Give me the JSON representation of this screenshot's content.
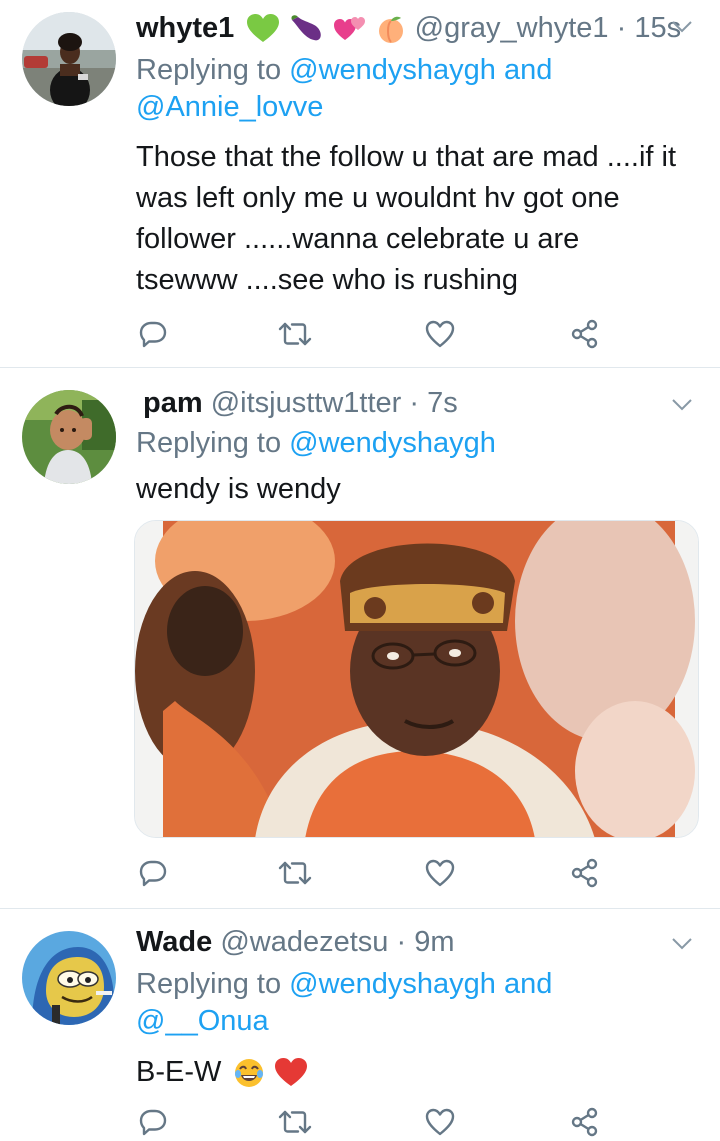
{
  "tweets": [
    {
      "name": "whyte1",
      "name_emoji": [
        "green-heart",
        "eggplant",
        "two-hearts",
        "peach"
      ],
      "handle": "@gray_whyte1",
      "separator": "·",
      "time": "15s",
      "replying_prefix": "Replying to",
      "mentions": [
        "@wendyshaygh",
        "@Annie_lovve"
      ],
      "mention_joiner": "and",
      "text_lines": [
        "Those that the follow u that are mad ....if it",
        "was left only me u wouldnt hv got one",
        "follower ......wanna celebrate u are",
        "tsewww ....see who is rushing"
      ]
    },
    {
      "name": "pam",
      "handle": "@itsjusttw1tter",
      "separator": "·",
      "time": "7s",
      "replying_prefix": "Replying to",
      "mentions": [
        "@wendyshaygh"
      ],
      "text_lines": [
        "wendy is wendy"
      ],
      "media": "photo"
    },
    {
      "name": "Wade",
      "handle": "@wadezetsu",
      "separator": "·",
      "time": "9m",
      "replying_prefix": "Replying to",
      "mentions": [
        "@wendyshaygh",
        "@__Onua"
      ],
      "mention_joiner": "and",
      "text_lines": [
        "B-E-W"
      ],
      "text_emoji": [
        "laughing-face",
        "red-heart"
      ]
    }
  ],
  "icons": [
    "reply-icon",
    "retweet-icon",
    "like-icon",
    "share-icon",
    "chevron-down-icon"
  ],
  "colors": {
    "text": "#14171a",
    "muted": "#657786",
    "link": "#1da1f2",
    "divider": "#e1e8ed"
  }
}
